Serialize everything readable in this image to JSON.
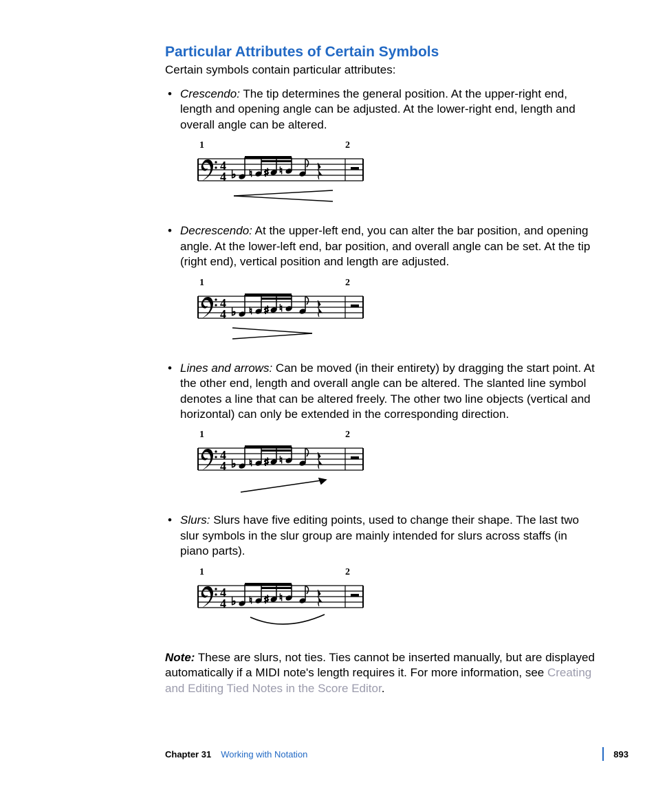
{
  "heading": "Particular Attributes of Certain Symbols",
  "intro": "Certain symbols contain particular attributes:",
  "items": [
    {
      "term": "Crescendo:",
      "text": "  The tip determines the general position. At the upper-right end, length and opening angle can be adjusted. At the lower-right end, length and overall angle can be altered."
    },
    {
      "term": "Decrescendo:",
      "text": "  At the upper-left end, you can alter the bar position, and opening angle. At the lower-left end, bar position, and overall angle can be set. At the tip (right end), vertical position and length are adjusted."
    },
    {
      "term": "Lines and arrows:",
      "text": "  Can be moved (in their entirety) by dragging the start point. At the other end, length and overall angle can be altered. The slanted line symbol denotes a line that can be altered freely. The other two line objects (vertical and horizontal) can only be extended in the corresponding direction."
    },
    {
      "term": "Slurs:",
      "text": "  Slurs have five editing points, used to change their shape. The last two slur symbols in the slur group are mainly intended for slurs across staffs (in piano parts)."
    }
  ],
  "note": {
    "label": "Note:",
    "text1": "  These are slurs, not ties. Ties cannot be inserted manually, but are displayed automatically if a MIDI note's length requires it. For more information, see ",
    "link": "Creating and Editing Tied Notes in the Score Editor",
    "text2": "."
  },
  "footer": {
    "chapter_label": "Chapter 31",
    "chapter_title": "Working with Notation",
    "page": "893"
  },
  "measures": {
    "m1": "1",
    "m2": "2"
  }
}
